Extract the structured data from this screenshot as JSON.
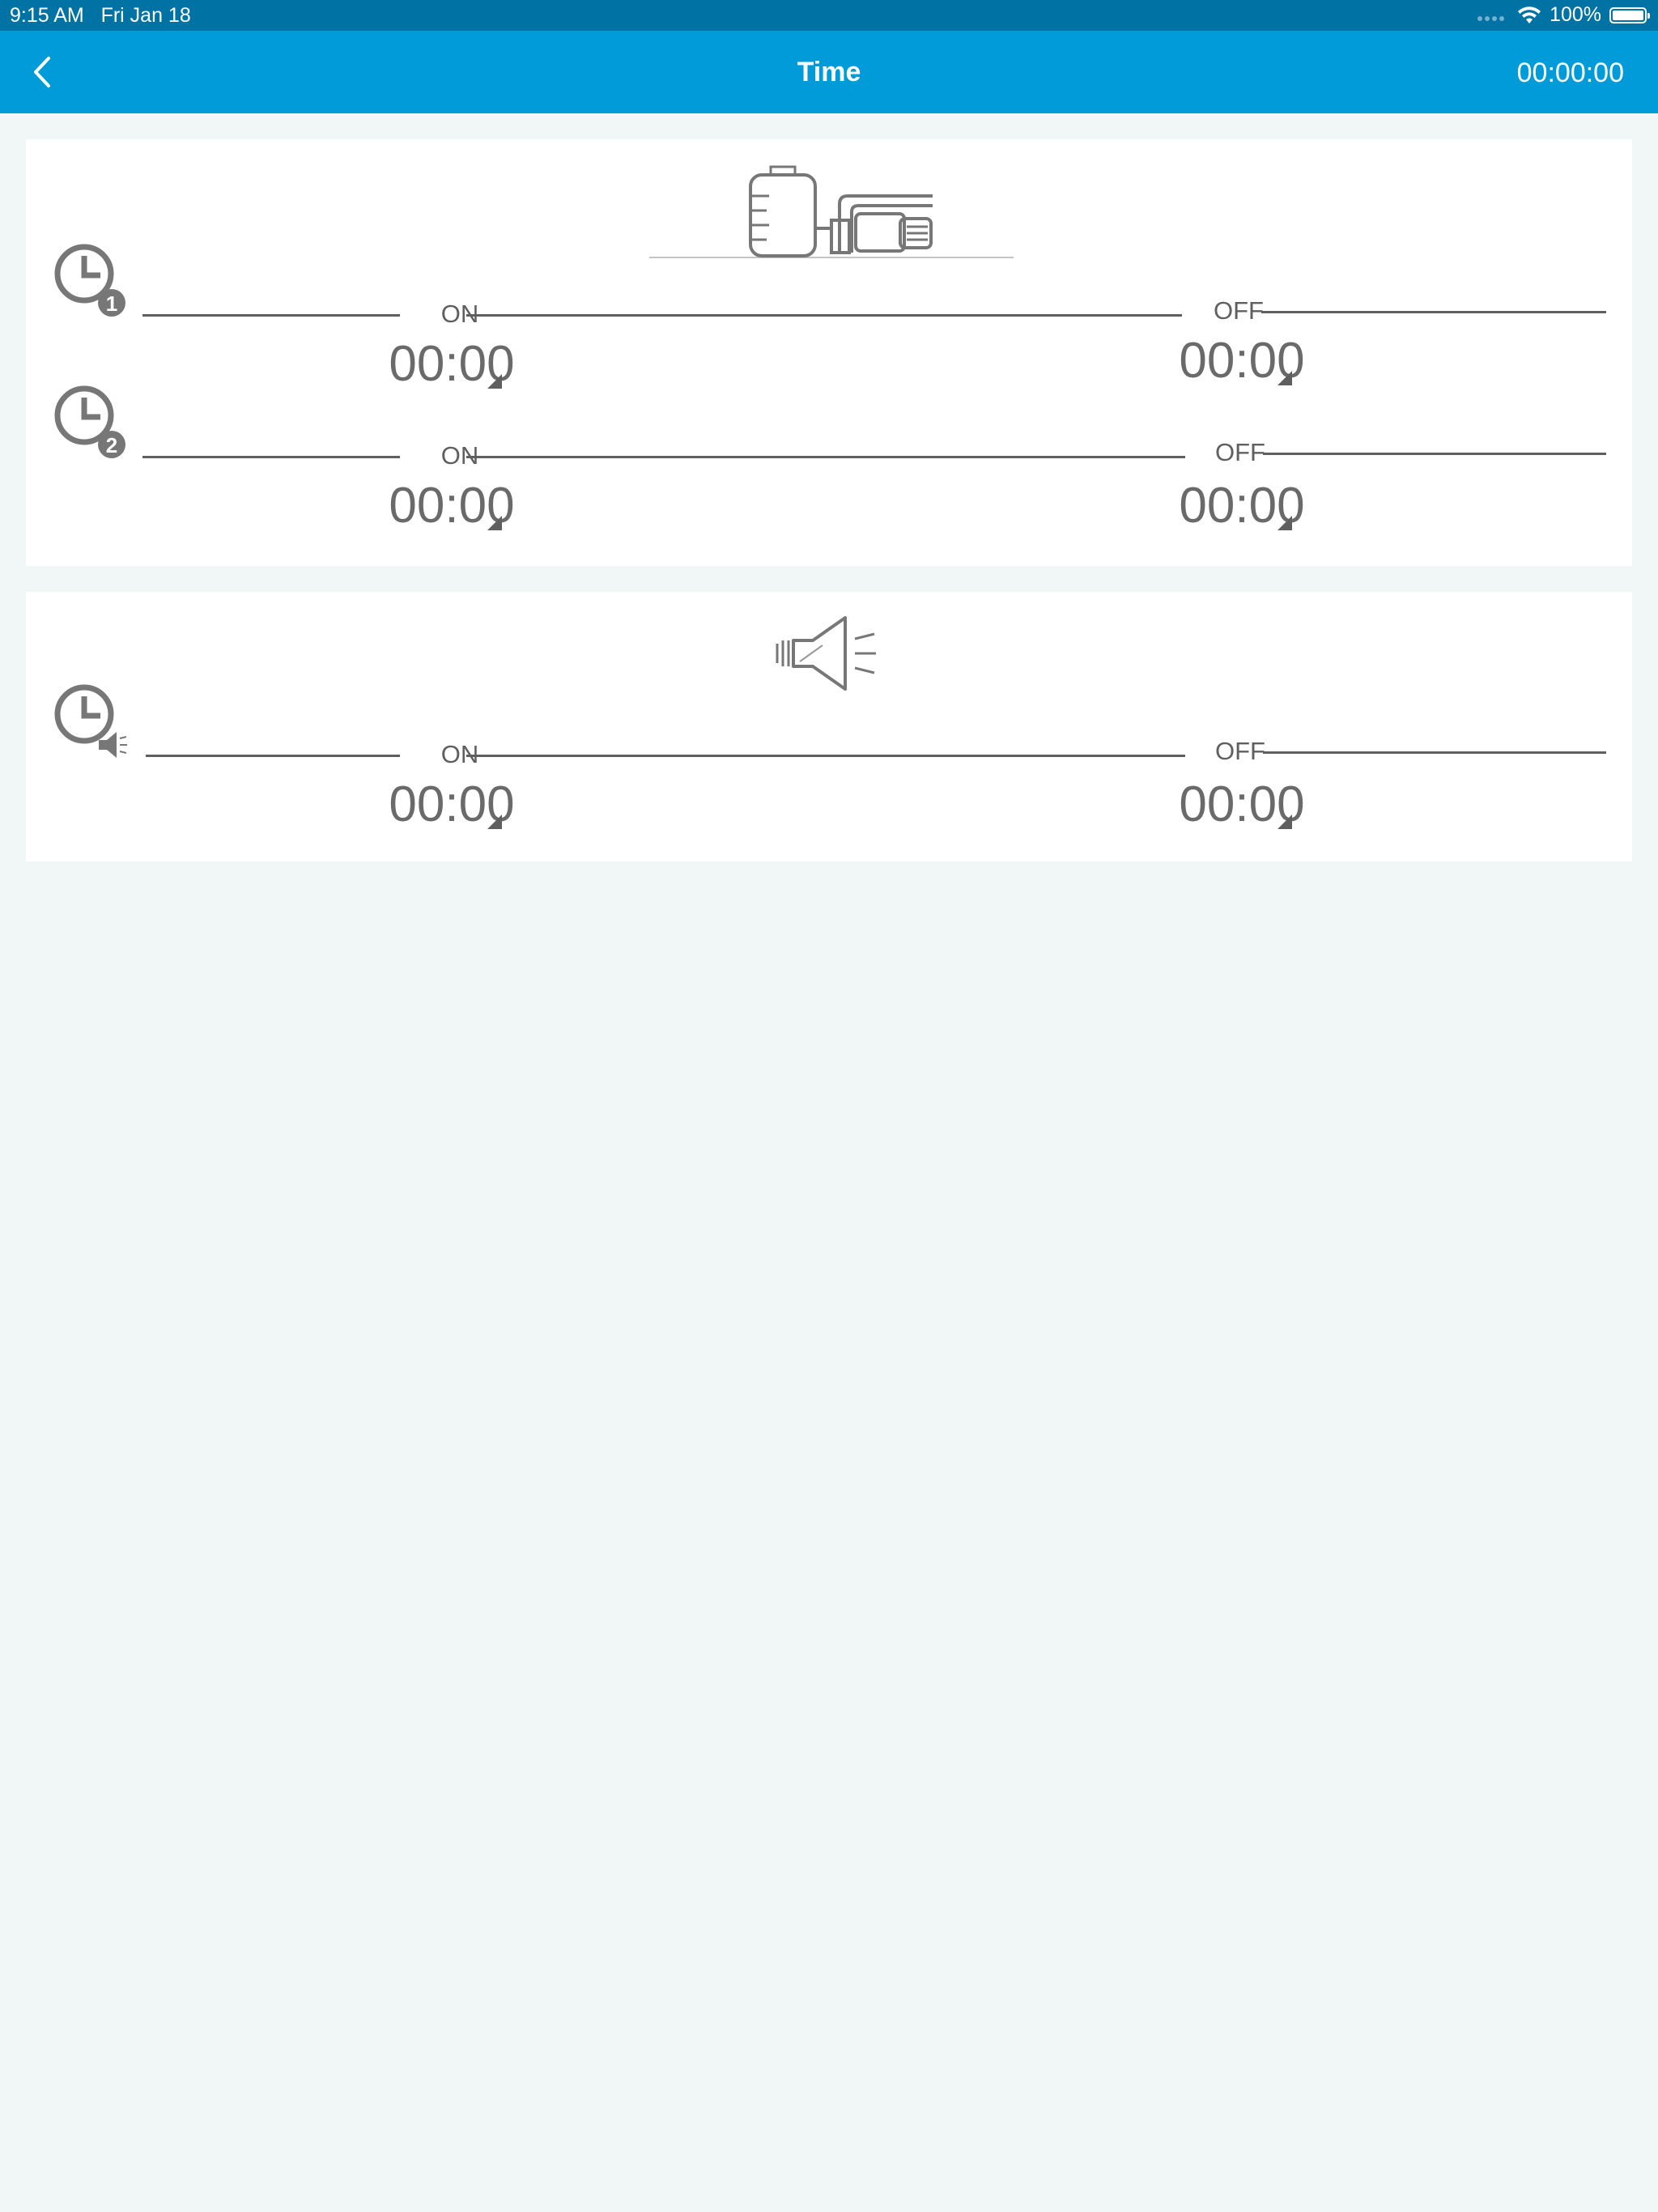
{
  "status_bar": {
    "time": "9:15 AM",
    "date": "Fri Jan 18",
    "battery": "100%",
    "battery_level": 1.0
  },
  "nav": {
    "title": "Time",
    "clock": "00:00:00",
    "back_icon": "chevron-left-icon"
  },
  "pump": {
    "icon": "pump-icon",
    "timers": [
      {
        "badge": "1",
        "on_label": "ON",
        "off_label": "OFF",
        "on_time": "00:00",
        "off_time": "00:00"
      },
      {
        "badge": "2",
        "on_label": "ON",
        "off_label": "OFF",
        "on_time": "00:00",
        "off_time": "00:00"
      }
    ]
  },
  "horn": {
    "icon": "horn-icon",
    "timers": [
      {
        "on_label": "ON",
        "off_label": "OFF",
        "on_time": "00:00",
        "off_time": "00:00"
      }
    ]
  },
  "colors": {
    "status_bar": "#0072a3",
    "nav_bar": "#009bd8",
    "background": "#f1f6f6",
    "line": "#5f5f5f",
    "value_text": "#6a6a6a"
  }
}
